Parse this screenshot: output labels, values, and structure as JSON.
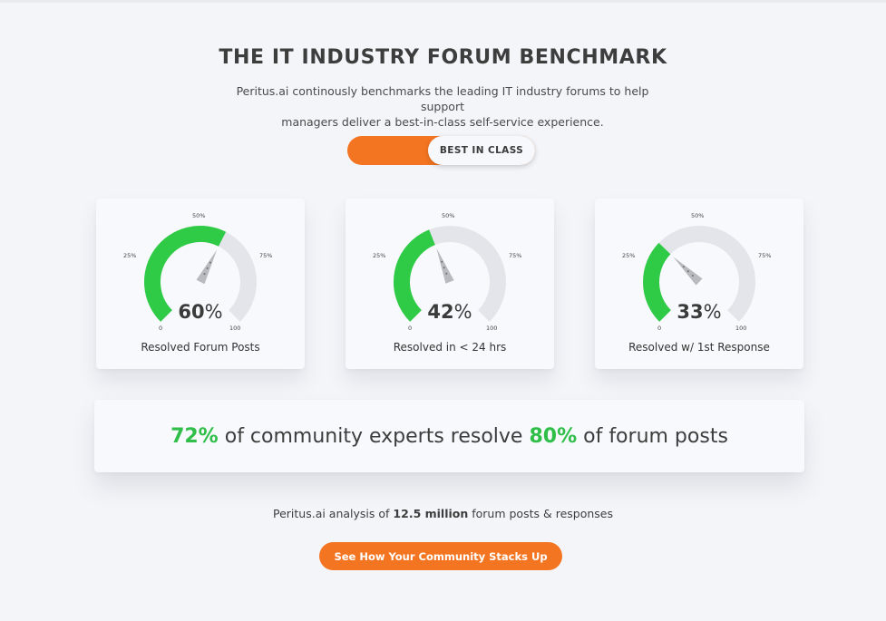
{
  "header": {
    "title": "THE IT INDUSTRY FORUM BENCHMARK",
    "subtitle_line1": "Peritus.ai continously benchmarks the leading IT industry forums to help support",
    "subtitle_line2": "managers deliver a best-in-class self-service experience."
  },
  "toggle": {
    "label": "BEST IN CLASS"
  },
  "colors": {
    "accent_orange": "#f47521",
    "gauge_green": "#2fcb47",
    "gauge_track": "#e4e5ea"
  },
  "gauge_ticks": [
    "0",
    "25%",
    "50%",
    "75%",
    "100"
  ],
  "gauges": [
    {
      "value": 60,
      "value_text": "60",
      "unit": "%",
      "label": "Resolved Forum Posts"
    },
    {
      "value": 42,
      "value_text": "42",
      "unit": "%",
      "label": "Resolved in < 24 hrs"
    },
    {
      "value": 33,
      "value_text": "33",
      "unit": "%",
      "label": "Resolved w/ 1st Response"
    }
  ],
  "banner": {
    "stat1": "72%",
    "text1": " of community experts resolve ",
    "stat2": "80%",
    "text2": " of forum posts"
  },
  "analysis": {
    "prefix": "Peritus.ai analysis of ",
    "highlight": "12.5 million",
    "suffix": " forum posts & responses"
  },
  "cta": {
    "label": "See How Your Community Stacks Up"
  }
}
